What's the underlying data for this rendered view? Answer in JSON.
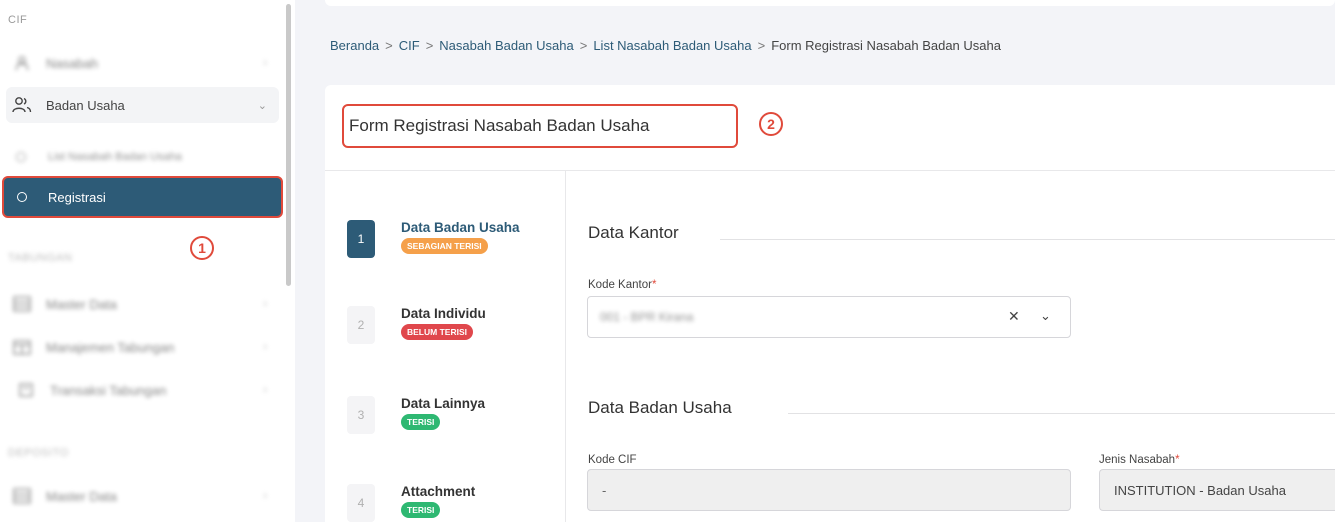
{
  "sidebar": {
    "section_cif": "CIF",
    "item_nasabah": "Nasabah",
    "item_badan_usaha": "Badan Usaha",
    "sub_list": "List Nasabah Badan Usaha",
    "item_registrasi": "Registrasi",
    "section_tabungan": "TABUNGAN",
    "item_master_data": "Master Data",
    "item_manajemen_tabungan": "Manajemen Tabungan",
    "item_transaksi_tabungan": "Transaksi Tabungan",
    "section_deposito": "DEPOSITO",
    "item_master_data_2": "Master Data"
  },
  "markers": {
    "one": "1",
    "two": "2"
  },
  "breadcrumb": {
    "items": [
      "Beranda",
      "CIF",
      "Nasabah Badan Usaha",
      "List Nasabah Badan Usaha"
    ],
    "current": "Form Registrasi Nasabah Badan Usaha",
    "separator": ">"
  },
  "form": {
    "title": "Form Registrasi Nasabah Badan Usaha",
    "steps": [
      {
        "num": "1",
        "title": "Data Badan Usaha",
        "badge": "SEBAGIAN TERISI",
        "badge_color": "#f5a04a"
      },
      {
        "num": "2",
        "title": "Data Individu",
        "badge": "BELUM TERISI",
        "badge_color": "#e0474c"
      },
      {
        "num": "3",
        "title": "Data Lainnya",
        "badge": "TERISI",
        "badge_color": "#2eb872"
      },
      {
        "num": "4",
        "title": "Attachment",
        "badge": "TERISI",
        "badge_color": "#2eb872"
      }
    ],
    "section_kantor": "Data Kantor",
    "kode_kantor_label": "Kode Kantor",
    "kode_kantor_value": "001 - BPR Kirana",
    "section_badan_usaha": "Data Badan Usaha",
    "kode_cif_label": "Kode CIF",
    "kode_cif_value": "-",
    "jenis_nasabah_label": "Jenis Nasabah",
    "jenis_nasabah_value": "INSTITUTION - Badan Usaha",
    "required_mark": "*"
  },
  "icons": {
    "clear": "✕",
    "dropdown": "⌄",
    "chevron_right": "›",
    "chevron_down": "⌄"
  }
}
